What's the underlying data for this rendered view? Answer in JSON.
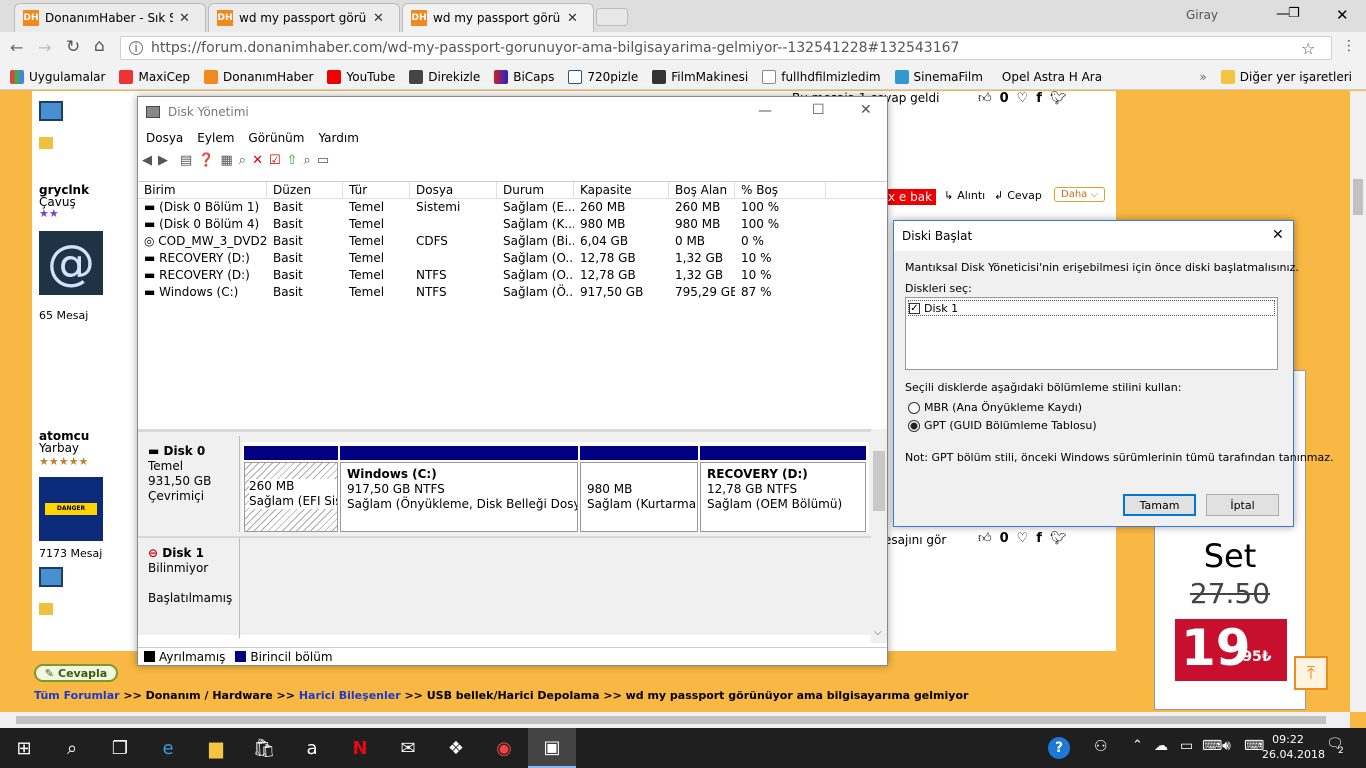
{
  "browser": {
    "tabs": [
      {
        "title": "DonanımHaber - Sık Sık ",
        "icon": "DH"
      },
      {
        "title": "wd my passport görünüy",
        "icon": "DH"
      },
      {
        "title": "wd my passport görünüy",
        "icon": "DH"
      }
    ],
    "user": "Giray",
    "url": "https://forum.donanimhaber.com/wd-my-passport-gorunuyor-ama-bilgisayarima-gelmiyor--132541228#132543167",
    "bookmarks": [
      "Uygulamalar",
      "MaxiCep",
      "DonanımHaber",
      "YouTube",
      "Direkizle",
      "BiCaps",
      "720pizle",
      "FilmMakinesi",
      "fullhdfilmizledim",
      "SinemaFilm",
      "Opel Astra H Araç Uy"
    ],
    "other_bookmarks": "Diğer yer işaretleri"
  },
  "forum": {
    "users": [
      {
        "name": "gryclnk",
        "rank": "Çavuş",
        "posts": "65 Mesaj"
      },
      {
        "name": "atomcu",
        "rank": "Yarbay",
        "posts": "7173 Mesaj"
      }
    ],
    "snippet1": "Bu mesaja 1 cevap geldi",
    "snippet2": "esajını gör",
    "likes": "0",
    "alinti": "Alıntı",
    "cevap": "Cevap",
    "daha": "Daha",
    "xebak": "x e bak",
    "cevapla": "Cevapla",
    "breadcrumb_prefix": "Tüm Forumlar",
    "breadcrumb_rest": " >> Donanım / Hardware >> ",
    "breadcrumb_link": "Harici Bileşenler",
    "breadcrumb_tail": " >> USB bellek/Harici Depolama >> wd my passport görünüyor ama bilgisayarıma gelmiyor",
    "ad_set": "Set",
    "ad_old": "27.50",
    "ad_new": "19",
    "ad_cents": ",95₺",
    "danger": "DANGER"
  },
  "disk_mgmt": {
    "title": "Disk Yönetimi",
    "menu": [
      "Dosya",
      "Eylem",
      "Görünüm",
      "Yardım"
    ],
    "columns": [
      "Birim",
      "Düzen",
      "Tür",
      "Dosya Sistemi",
      "Durum",
      "Kapasite",
      "Boş Alan",
      "% Boş"
    ],
    "rows": [
      [
        "(Disk 0 Bölüm 1)",
        "Basit",
        "Temel",
        "",
        "Sağlam (E...",
        "260 MB",
        "260 MB",
        "100 %"
      ],
      [
        "(Disk 0 Bölüm 4)",
        "Basit",
        "Temel",
        "",
        "Sağlam (K...",
        "980 MB",
        "980 MB",
        "100 %"
      ],
      [
        "COD_MW_3_DVD2...",
        "Basit",
        "Temel",
        "CDFS",
        "Sağlam (Bi...",
        "6,04 GB",
        "0 MB",
        "0 %"
      ],
      [
        "RECOVERY (D:)",
        "Basit",
        "Temel",
        "",
        "Sağlam (O...",
        "12,78 GB",
        "1,32 GB",
        "10 %"
      ],
      [
        "RECOVERY (D:)",
        "Basit",
        "Temel",
        "NTFS",
        "Sağlam (O...",
        "12,78 GB",
        "1,32 GB",
        "10 %"
      ],
      [
        "Windows (C:)",
        "Basit",
        "Temel",
        "NTFS",
        "Sağlam (Ö...",
        "917,50 GB",
        "795,29 GB",
        "87 %"
      ]
    ],
    "disk0": {
      "name": "Disk 0",
      "type": "Temel",
      "size": "931,50 GB",
      "status": "Çevrimiçi"
    },
    "disk1": {
      "name": "Disk 1",
      "type": "Bilinmiyor",
      "status": "Başlatılmamış"
    },
    "partitions": [
      {
        "title": "",
        "size": "260 MB",
        "status": "Sağlam (EFI Sist"
      },
      {
        "title": "Windows  (C:)",
        "size": "917,50 GB NTFS",
        "status": "Sağlam (Önyükleme, Disk Belleği Dosyası, I"
      },
      {
        "title": "",
        "size": "980 MB",
        "status": "Sağlam (Kurtarma B"
      },
      {
        "title": "RECOVERY  (D:)",
        "size": "12,78 GB NTFS",
        "status": "Sağlam (OEM Bölümü)"
      }
    ],
    "legend": [
      "Ayrılmamış",
      "Birincil bölüm"
    ]
  },
  "dialog": {
    "title": "Diski Başlat",
    "intro": "Mantıksal Disk Yöneticisi'nin erişebilmesi için önce diski başlatmalısınız.",
    "select_label": "Diskleri seç:",
    "disk_item": "Disk 1",
    "style_label": "Seçili disklerde aşağıdaki bölümleme stilini kullan:",
    "mbr": "MBR (Ana Önyükleme Kaydı)",
    "gpt": "GPT (GUID Bölümleme Tablosu)",
    "note": "Not: GPT bölüm stili, önceki Windows sürümlerinin tümü tarafından tanınmaz.",
    "ok": "Tamam",
    "cancel": "İptal"
  },
  "taskbar": {
    "time": "09:22",
    "date": "26.04.2018",
    "notif": "2"
  },
  "colors": {
    "accent": "#f9b843",
    "partition_bar": "#000080",
    "ok_border": "#0078d7"
  }
}
